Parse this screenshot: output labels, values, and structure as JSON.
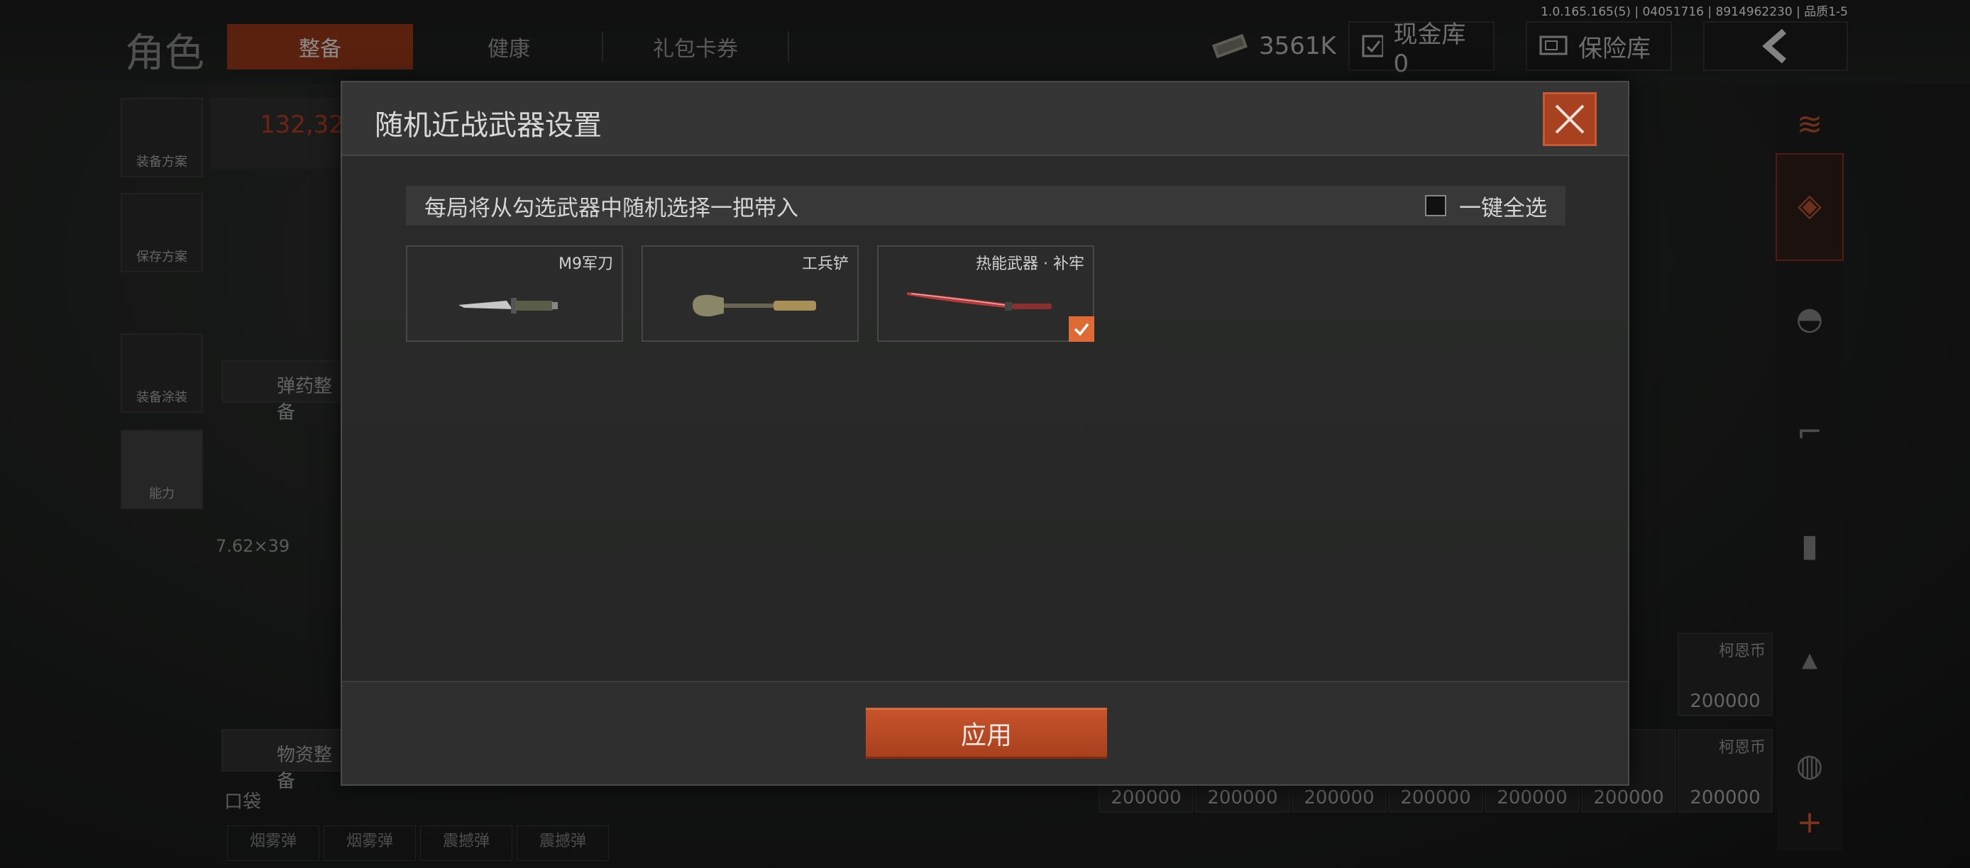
{
  "version": "1.0.165.165(5) | 04051716 | 8914962230 | 品质1-5",
  "background": {
    "page_title": "角色",
    "tabs": [
      "整备",
      "健康",
      "礼包卡券"
    ],
    "currency_value": "3561K",
    "cash_storage": "现金库 0",
    "insurance": "保险库",
    "capacity": "132,32",
    "left_items": [
      "装备方案",
      "保存方案",
      "装备涂装",
      "能力"
    ],
    "ammo_button": "弹药整备",
    "supplies_button": "物资整备",
    "caliber": "7.62×39",
    "pocket": "口袋",
    "pocket_items": [
      "烟雾弹",
      "烟雾弹",
      "震撼弹",
      "震撼弹"
    ],
    "money_label": "柯恩币",
    "money_value": "200000"
  },
  "dialog": {
    "title": "随机近战武器设置",
    "info": "每局将从勾选武器中随机选择一把带入",
    "select_all": "一键全选",
    "select_all_checked": false,
    "weapons": [
      {
        "name": "M9军刀",
        "checked": false,
        "icon": "knife-icon"
      },
      {
        "name": "工兵铲",
        "checked": false,
        "icon": "shovel-icon"
      },
      {
        "name": "热能武器 · 补牢",
        "checked": true,
        "icon": "thermal-blade-icon"
      }
    ],
    "apply": "应用"
  },
  "colors": {
    "accent": "#c7532b",
    "check": "#e06a35",
    "tab_active": "#8c3318"
  }
}
